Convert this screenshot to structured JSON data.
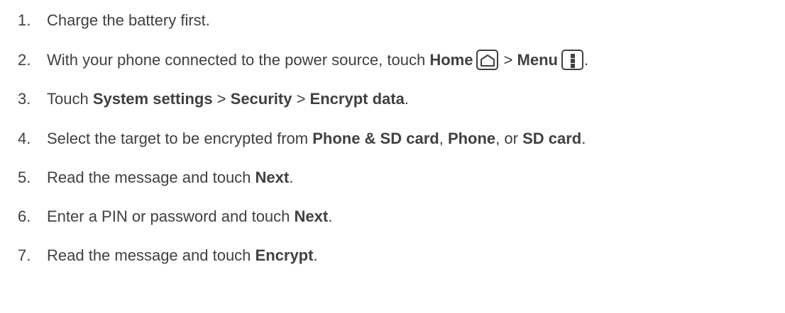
{
  "steps": [
    {
      "num": "1.",
      "parts": [
        {
          "t": "Charge the battery first."
        }
      ]
    },
    {
      "num": "2.",
      "parts": [
        {
          "t": "With your phone connected to the power source, touch "
        },
        {
          "t": "Home",
          "b": true
        },
        {
          "icon": "home-icon"
        },
        {
          "t": " > "
        },
        {
          "t": "Menu",
          "b": true
        },
        {
          "icon": "menu-icon"
        },
        {
          "t": "."
        }
      ]
    },
    {
      "num": "3.",
      "parts": [
        {
          "t": "Touch "
        },
        {
          "t": "System settings",
          "b": true
        },
        {
          "t": " > "
        },
        {
          "t": "Security",
          "b": true
        },
        {
          "t": " > "
        },
        {
          "t": "Encrypt data",
          "b": true
        },
        {
          "t": "."
        }
      ]
    },
    {
      "num": "4.",
      "parts": [
        {
          "t": "Select the target to be encrypted from "
        },
        {
          "t": "Phone & SD card",
          "b": true
        },
        {
          "t": ", "
        },
        {
          "t": "Phone",
          "b": true
        },
        {
          "t": ", or "
        },
        {
          "t": "SD card",
          "b": true
        },
        {
          "t": "."
        }
      ]
    },
    {
      "num": "5.",
      "parts": [
        {
          "t": "Read the message and touch "
        },
        {
          "t": "Next",
          "b": true
        },
        {
          "t": "."
        }
      ]
    },
    {
      "num": "6.",
      "parts": [
        {
          "t": "Enter a PIN or password and touch "
        },
        {
          "t": "Next",
          "b": true
        },
        {
          "t": "."
        }
      ]
    },
    {
      "num": "7.",
      "parts": [
        {
          "t": "Read the message and touch "
        },
        {
          "t": "Encrypt",
          "b": true
        },
        {
          "t": "."
        }
      ]
    }
  ]
}
